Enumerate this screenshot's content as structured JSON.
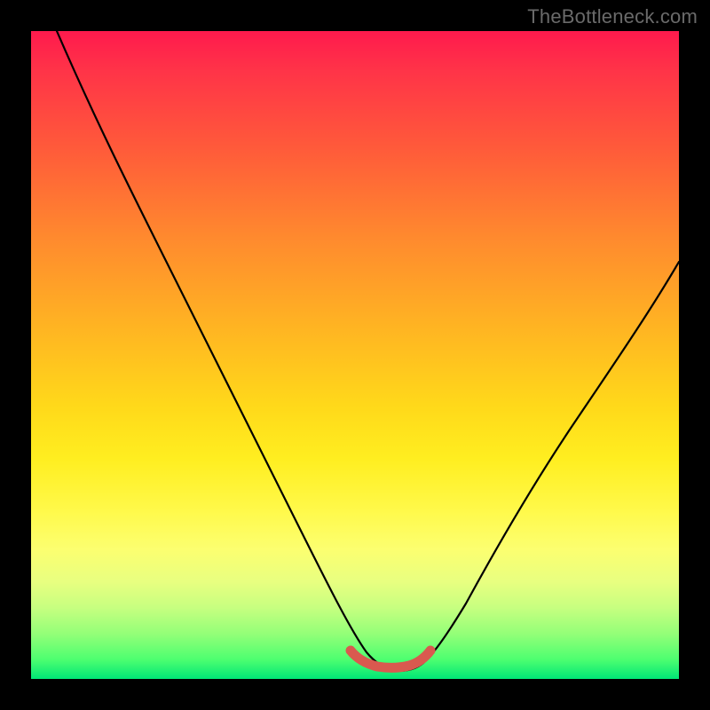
{
  "watermark": "TheBottleneck.com",
  "chart_data": {
    "type": "line",
    "title": "",
    "xlabel": "",
    "ylabel": "",
    "xlim": [
      0,
      100
    ],
    "ylim": [
      0,
      100
    ],
    "series": [
      {
        "name": "bottleneck-curve",
        "color": "#000000",
        "x": [
          4,
          8,
          12,
          16,
          20,
          24,
          28,
          32,
          36,
          40,
          44,
          48,
          50,
          52,
          54,
          56,
          58,
          60,
          62,
          64,
          68,
          72,
          76,
          80,
          84,
          88,
          92,
          96,
          100
        ],
        "y": [
          100,
          92,
          84,
          76,
          68,
          60,
          52,
          44,
          36,
          28,
          20,
          12,
          8,
          4,
          2,
          1,
          1,
          2,
          4,
          8,
          16,
          24,
          32,
          40,
          48,
          54,
          59,
          63,
          66
        ]
      },
      {
        "name": "target-band",
        "color": "#d9594f",
        "x": [
          49,
          50,
          52,
          54,
          56,
          58,
          60,
          61
        ],
        "y": [
          4.5,
          3.5,
          2.8,
          2.5,
          2.5,
          2.8,
          3.5,
          4.5
        ]
      }
    ],
    "gradient_stops": [
      {
        "pos": 0.0,
        "color": "#ff1a4d"
      },
      {
        "pos": 0.3,
        "color": "#ff8a2e"
      },
      {
        "pos": 0.6,
        "color": "#ffe61a"
      },
      {
        "pos": 0.85,
        "color": "#d4ff70"
      },
      {
        "pos": 1.0,
        "color": "#00e676"
      }
    ]
  }
}
